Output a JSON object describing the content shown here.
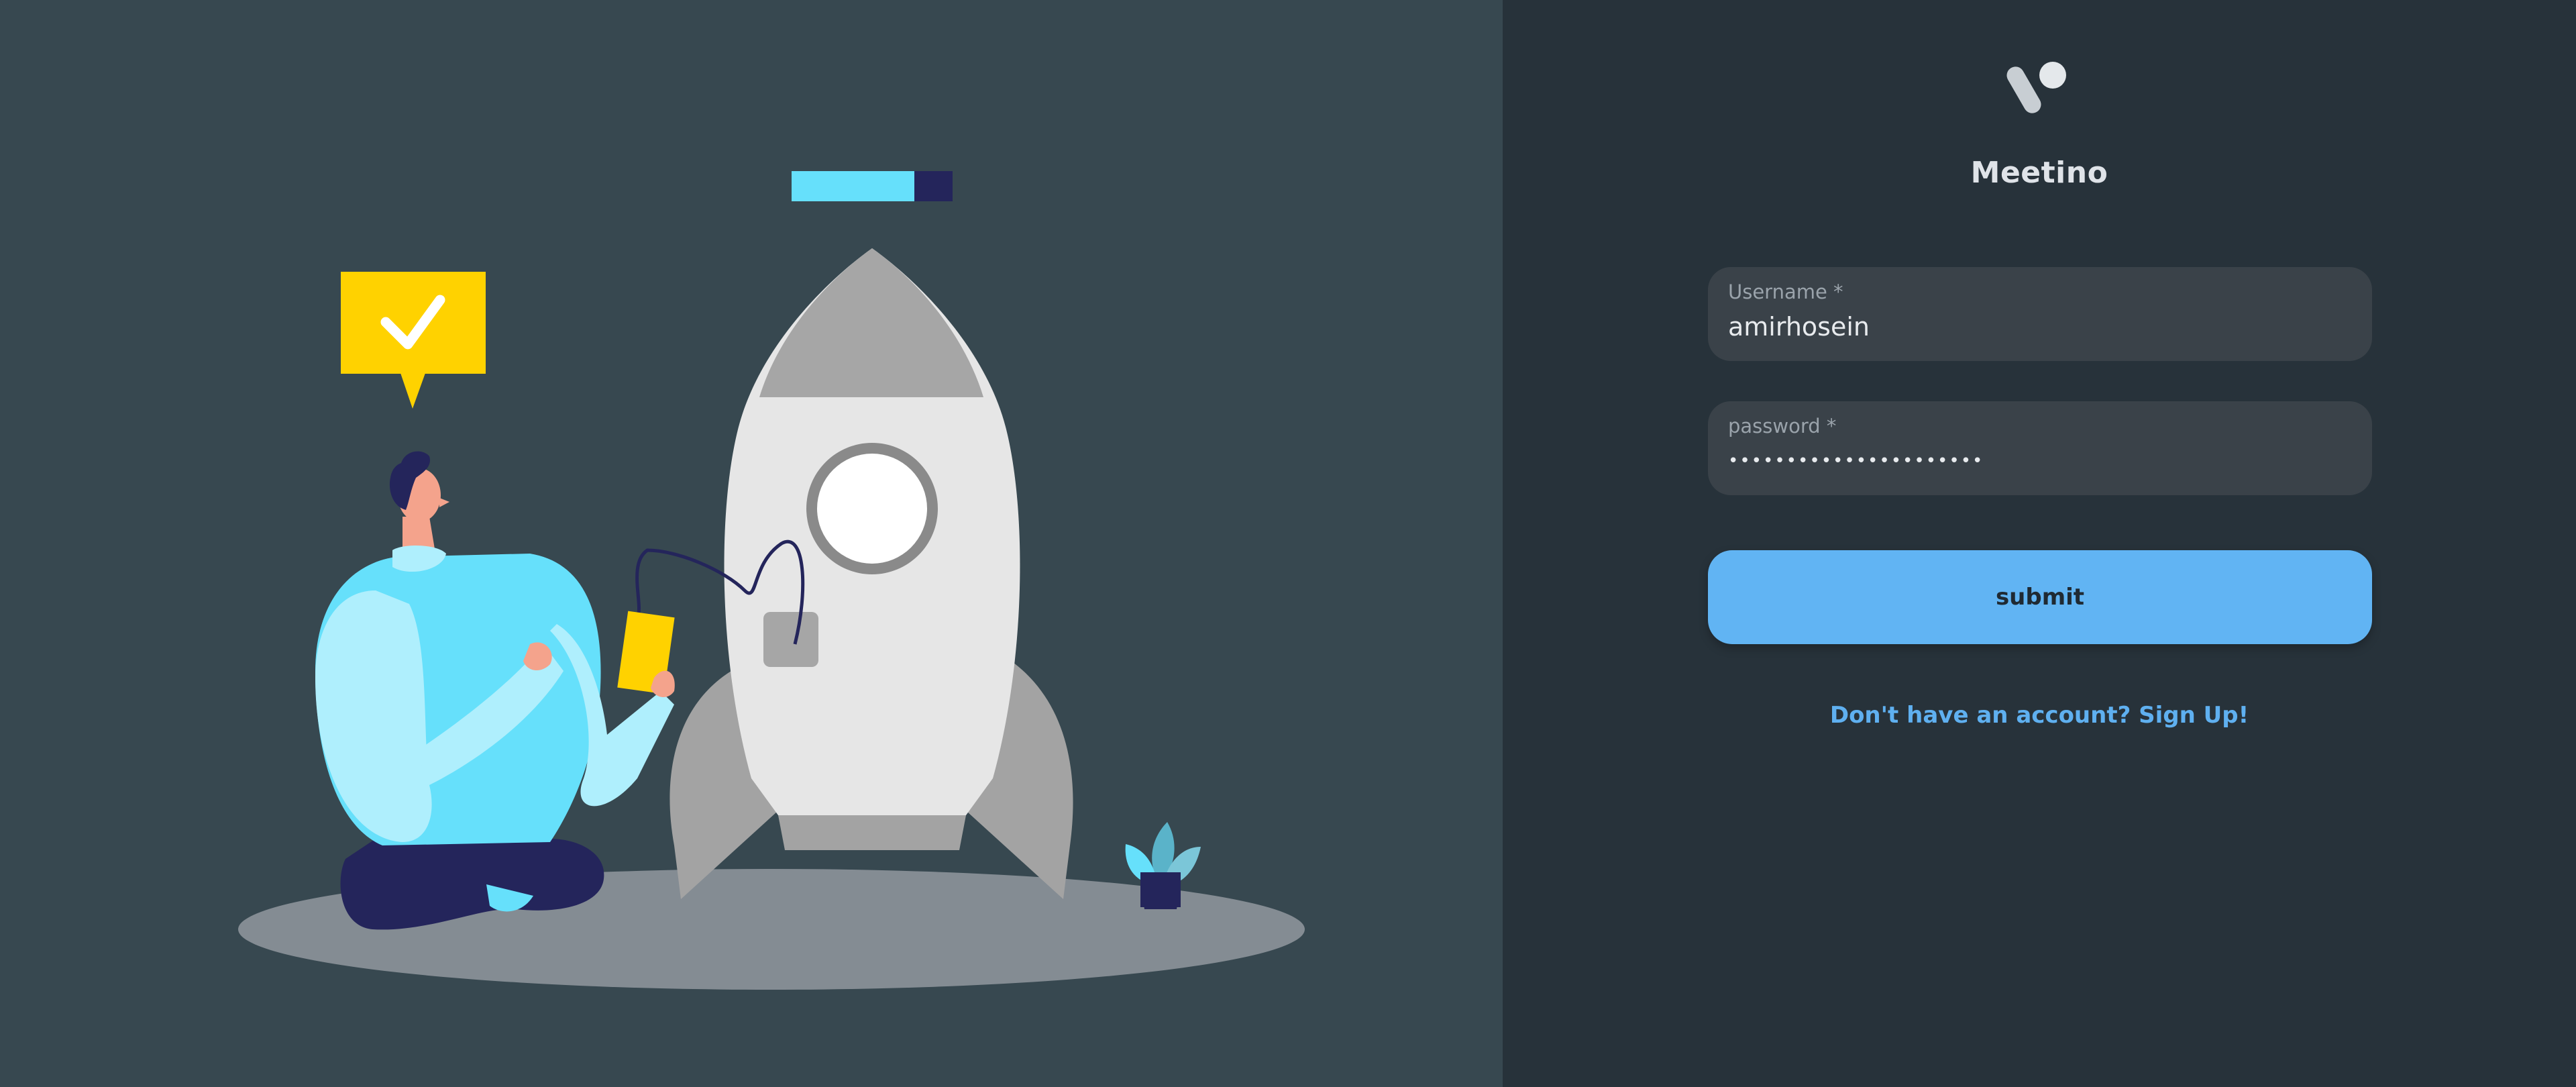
{
  "brand": {
    "name": "Meetino"
  },
  "form": {
    "username": {
      "label": "Username *",
      "value": "amirhosein"
    },
    "password": {
      "label": "password *",
      "value": "••••••••••••••••••••••"
    },
    "submit_label": "submit",
    "signup_link": "Don't have an account? Sign Up!"
  },
  "colors": {
    "left_background": "#374850",
    "right_background": "#27323a",
    "field_background": "#3a4249",
    "accent": "#61b4f3",
    "link": "#5fb0f0",
    "illustration_cyan": "#66e0fb",
    "illustration_navy": "#24255b",
    "illustration_yellow": "#ffd200"
  }
}
